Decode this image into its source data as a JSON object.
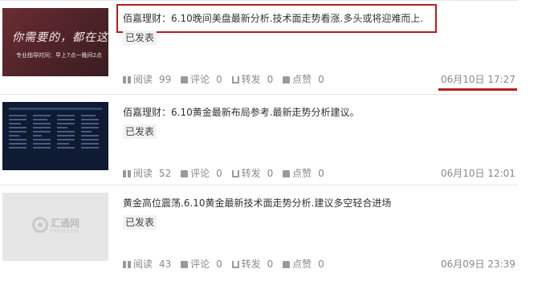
{
  "accent_color": "#b21f1f",
  "labels": {
    "read": "阅读",
    "comment": "评论",
    "share": "转发",
    "like": "点赞"
  },
  "posts": [
    {
      "title": "佰嘉理财：6.10晚间美盘最新分析.技术面走势看涨.多头或将迎难而上.",
      "status": "已发表",
      "thumb_text": "你需要的，都在这里",
      "thumb_subtext": "专业指导时间：早上7点一晚间2点",
      "read": "99",
      "comment": "0",
      "share": "0",
      "like": "0",
      "time": "06月10日 17:27",
      "highlighted": true
    },
    {
      "title": "佰嘉理财：6.10黄金最新布局参考.最新走势分析建议。",
      "status": "已发表",
      "read": "52",
      "comment": "0",
      "share": "0",
      "like": "0",
      "time": "06月10日 12:01"
    },
    {
      "title": "黄金高位震荡.6.10黄金最新技术面走势分析.建议多空轻合进场",
      "status": "已发表",
      "thumb_logo": "汇通网",
      "thumb_logo_sub": "FX678.COM",
      "read": "43",
      "comment": "0",
      "share": "0",
      "like": "0",
      "time": "06月09日 23:39"
    }
  ]
}
